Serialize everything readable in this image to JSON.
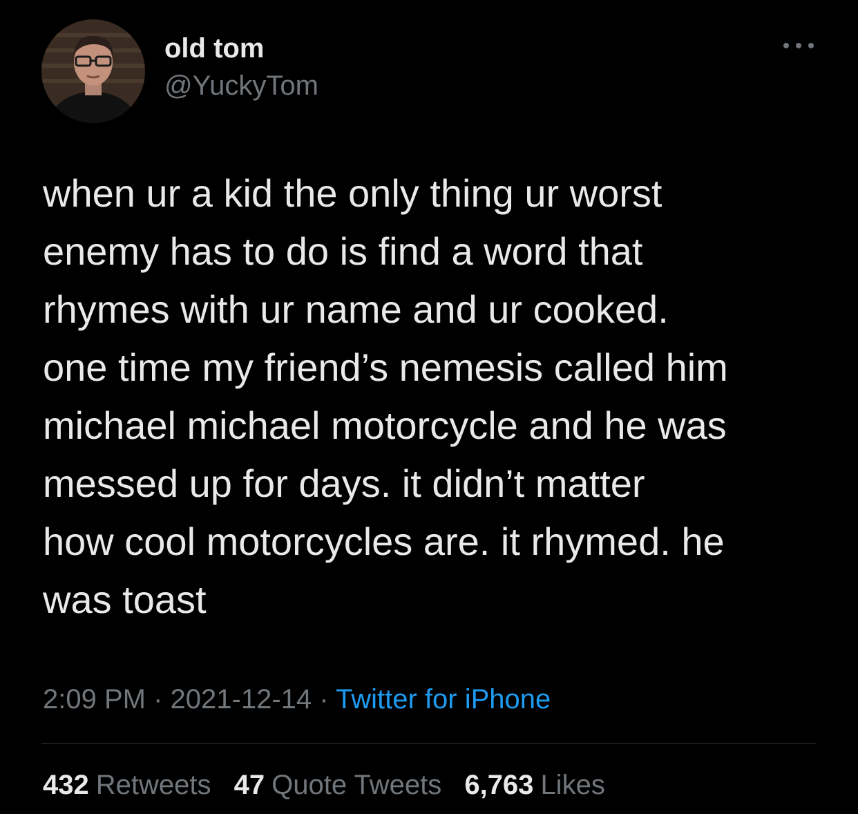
{
  "author": {
    "display_name": "old tom",
    "handle": "@YuckyTom"
  },
  "tweet": {
    "text": "when ur a kid the only thing ur worst\nenemy has to do is find a word that\nrhymes with ur name and ur cooked.\none time my friend’s nemesis called him\nmichael michael motorcycle and he was\nmessed up for days. it didn’t matter\nhow cool motorcycles are. it rhymed. he\nwas toast",
    "time": "2:09 PM",
    "separator": "·",
    "date": "2021-12-14",
    "source": "Twitter for iPhone"
  },
  "stats": {
    "retweets": {
      "count": "432",
      "label": "Retweets"
    },
    "quotes": {
      "count": "47",
      "label": "Quote Tweets"
    },
    "likes": {
      "count": "6,763",
      "label": "Likes"
    }
  },
  "icons": {
    "more": "more-horizontal-icon"
  },
  "colors": {
    "background": "#000000",
    "text": "#e7e9ea",
    "secondary": "#71767b",
    "accent": "#1d9bf0",
    "divider": "#2f3336"
  }
}
